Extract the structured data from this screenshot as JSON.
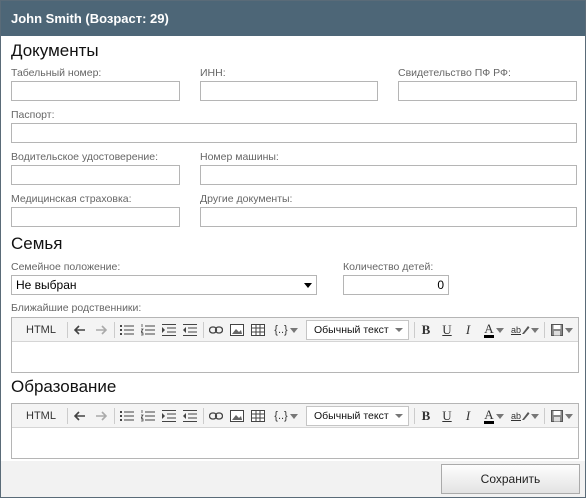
{
  "window": {
    "title": "John Smith (Возраст: 29)"
  },
  "documents": {
    "title": "Документы",
    "tab_number_label": "Табельный номер:",
    "inn_label": "ИНН:",
    "pf_label": "Свидетельство ПФ РФ:",
    "passport_label": "Паспорт:",
    "driver_license_label": "Водительское удостоверение:",
    "car_number_label": "Номер машины:",
    "insurance_label": "Медицинская страховка:",
    "other_docs_label": "Другие документы:"
  },
  "family": {
    "title": "Семья",
    "marital_label": "Семейное положение:",
    "marital_value": "Не выбран",
    "children_label": "Количество детей:",
    "children_value": "0",
    "relatives_label": "Ближайшие родственники:"
  },
  "education": {
    "title": "Образование"
  },
  "editor": {
    "html_label": "HTML",
    "format_value": "Обычный текст",
    "bold": "B",
    "underline": "U",
    "italic": "I",
    "font_color": "A",
    "highlight": "ab",
    "source_code": "{..}"
  },
  "footer": {
    "save_label": "Сохранить"
  }
}
